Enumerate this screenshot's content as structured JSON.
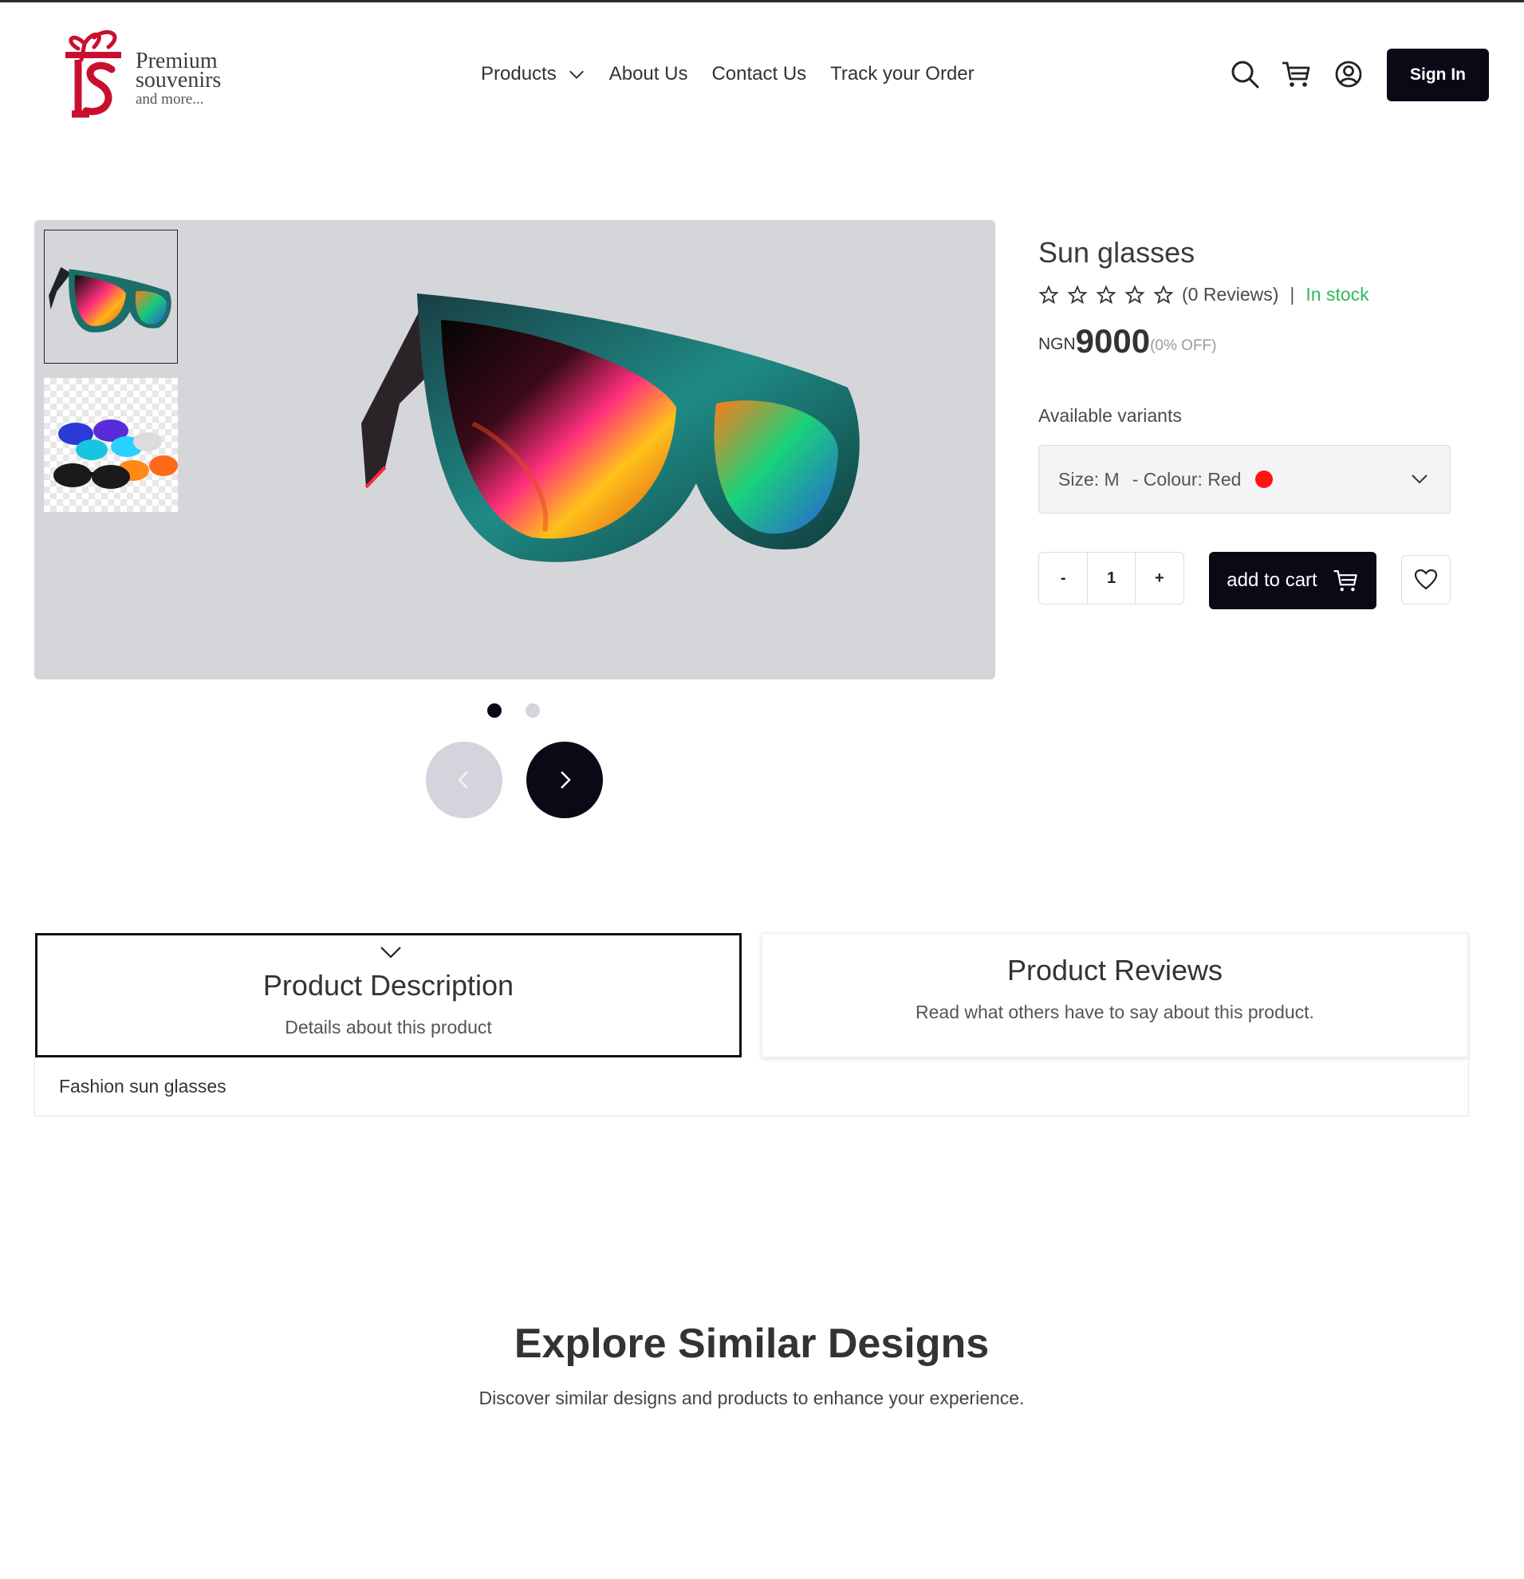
{
  "brand": {
    "line1": "Premium",
    "line2": "souvenirs",
    "line3": "and more...",
    "accent": "#c8102e"
  },
  "nav": {
    "items": [
      "Products",
      "About Us",
      "Contact Us",
      "Track your Order"
    ]
  },
  "header": {
    "icons": [
      "search-icon",
      "cart-icon",
      "user-icon"
    ],
    "sign_in": "Sign In"
  },
  "product": {
    "title": "Sun glasses",
    "rating_count": "(0 Reviews)",
    "separator": "|",
    "stock": "In stock",
    "currency": "NGN",
    "price": "9000",
    "discount": "(0% OFF)",
    "variants_label": "Available variants",
    "variant_size": "Size: M",
    "variant_colour": "- Colour: Red",
    "variant_colour_hex": "#ff1414",
    "qty_minus": "-",
    "qty_value": "1",
    "qty_plus": "+",
    "add_to_cart": "add to cart",
    "stock_color": "#2eb85c"
  },
  "tabs": {
    "description_title": "Product Description",
    "description_sub": "Details about this product",
    "reviews_title": "Product Reviews",
    "reviews_sub": "Read what others have to say about this product.",
    "description_text": "Fashion sun glasses"
  },
  "explore": {
    "title": "Explore Similar Designs",
    "subtitle": "Discover similar designs and products to enhance your experience."
  },
  "colors": {
    "dark": "#0a0a16",
    "inactive": "#d3d4dc"
  }
}
